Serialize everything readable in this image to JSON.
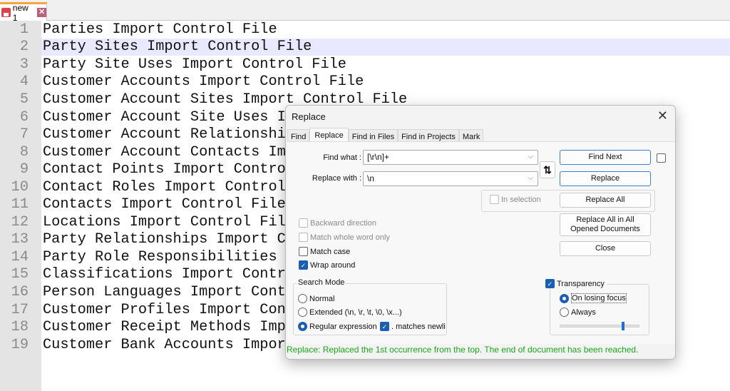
{
  "tab": {
    "label": "new 1",
    "icon": "save-icon",
    "close": "✕"
  },
  "editor": {
    "current_line": 2,
    "lines": [
      "Parties Import Control File",
      "Party Sites Import Control File",
      "Party Site Uses Import Control File",
      "Customer Accounts Import Control File",
      "Customer Account Sites Import Control File",
      "Customer Account Site Uses I",
      "Customer Account Relationshi",
      "Customer Account Contacts Im",
      "Contact Points Import Contro",
      "Contact Roles Import Control",
      "Contacts Import Control File",
      "Locations Import Control Fil",
      "Party Relationships Import C",
      "Party Role Responsibilities ",
      "Classifications Import Contr",
      "Person Languages Import Cont",
      "Customer Profiles Import Con",
      "Customer Receipt Methods Imp",
      "Customer Bank Accounts Impor"
    ]
  },
  "dialog": {
    "title": "Replace",
    "close": "✕",
    "tabs": [
      "Find",
      "Replace",
      "Find in Files",
      "Find in Projects",
      "Mark"
    ],
    "active_tab": "Replace",
    "find_label": "Find what :",
    "find_value": "[\\r\\n]+",
    "replace_label": "Replace with :",
    "replace_value": "\\n",
    "swap": "⇅",
    "buttons": {
      "find_next": "Find Next",
      "replace": "Replace",
      "replace_all": "Replace All",
      "replace_all_opened": "Replace All in All Opened Documents",
      "close": "Close"
    },
    "in_selection": "In selection",
    "options": {
      "backward": "Backward direction",
      "whole_word": "Match whole word only",
      "match_case": "Match case",
      "wrap": "Wrap around"
    },
    "search_mode": {
      "title": "Search Mode",
      "normal": "Normal",
      "extended": "Extended (\\n, \\r, \\t, \\0, \\x...)",
      "regex": "Regular expression",
      "dot_newline": ". matches newline",
      "selected": "Regular expression"
    },
    "transparency": {
      "label": "Transparency",
      "on_losing_focus": "On losing focus",
      "always": "Always",
      "checked": true,
      "selected": "On losing focus",
      "level_percent": 80
    },
    "status": "Replace: Replaced the 1st occurrence from the top. The end of document has been reached.",
    "status_color": "#18a818"
  }
}
